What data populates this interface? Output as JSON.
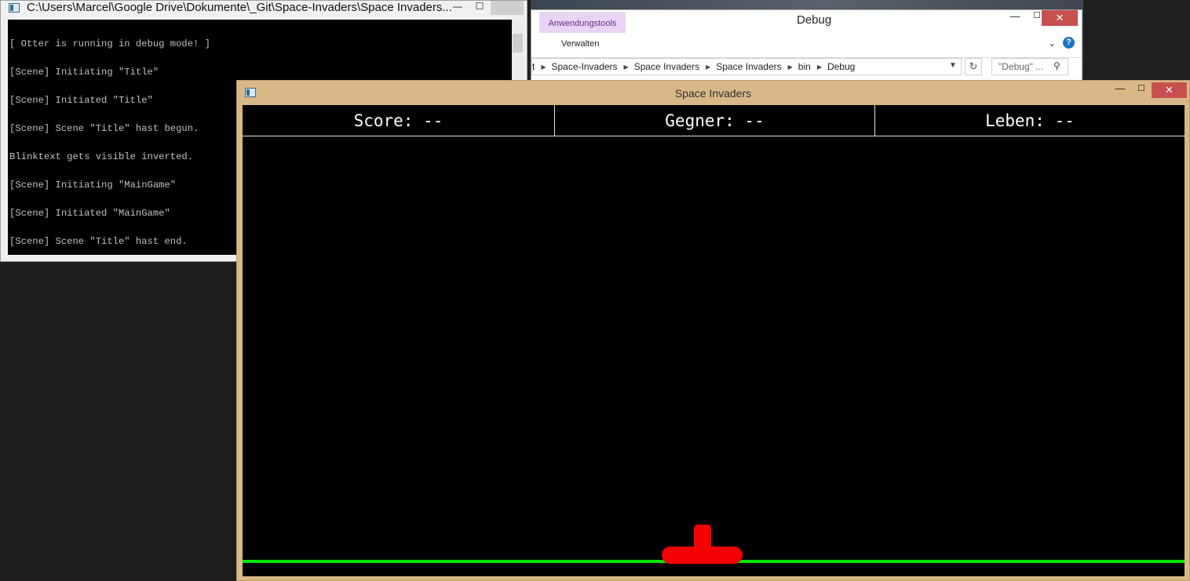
{
  "console": {
    "title": "C:\\Users\\Marcel\\Google Drive\\Dokumente\\_Git\\Space-Invaders\\Space Invaders...",
    "minimize_glyph": "—",
    "maximize_glyph": "☐",
    "lines": [
      "[ Otter is running in debug mode! ]",
      "[Scene] Initiating \"Title\"",
      "[Scene] Initiated \"Title\"",
      "[Scene] Scene \"Title\" hast begun.",
      "Blinktext gets visible inverted.",
      "[Scene] Initiating \"MainGame\"",
      "[Scene] Initiated \"MainGame\"",
      "[Scene] Scene \"Title\" hast end."
    ]
  },
  "explorer": {
    "context_tab": "Anwendungstools",
    "title": "Debug",
    "ribbon_tab": "Verwalten",
    "breadcrumb": [
      "t",
      "Space-Invaders",
      "Space Invaders",
      "Space Invaders",
      "bin",
      "Debug"
    ],
    "search_placeholder": "\"Debug\" ...",
    "min_glyph": "—",
    "max_glyph": "☐",
    "close_glyph": "✕",
    "help_glyph": "?",
    "chevron_glyph": "⌄"
  },
  "game": {
    "title": "Space Invaders",
    "min_glyph": "—",
    "max_glyph": "☐",
    "close_glyph": "✕",
    "hud": {
      "score": "Score: --",
      "enemies": "Gegner: --",
      "lives": "Leben: --"
    },
    "colors": {
      "ground": "#00e600",
      "player": "#f50000",
      "background": "#000000"
    }
  }
}
